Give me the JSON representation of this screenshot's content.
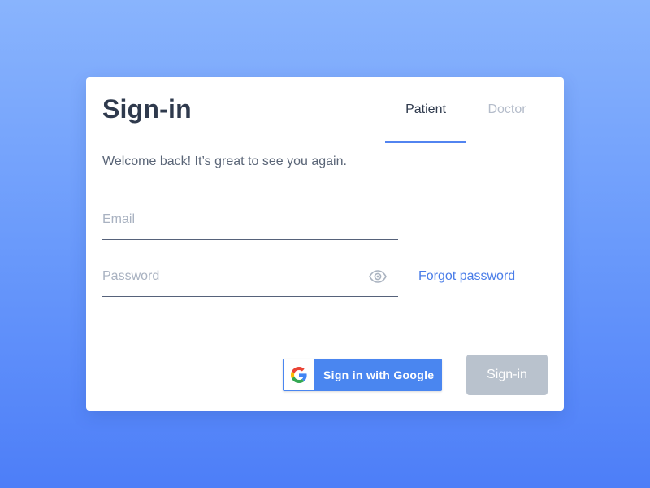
{
  "card": {
    "title": "Sign-in",
    "tabs": [
      {
        "label": "Patient",
        "active": true
      },
      {
        "label": "Doctor",
        "active": false
      }
    ],
    "welcome_text": "Welcome back! It’s great to see you again."
  },
  "form": {
    "email": {
      "placeholder": "Email",
      "value": ""
    },
    "password": {
      "placeholder": "Password",
      "value": ""
    },
    "show_password_icon": "eye-icon",
    "forgot_password_label": "Forgot password"
  },
  "footer": {
    "google_button_label": "Sign in with Google",
    "google_icon": "google-logo-icon",
    "signin_button_label": "Sign-in"
  },
  "colors": {
    "accent": "#5284f0",
    "link": "#4a7de8",
    "google_button": "#4a86f0",
    "disabled_button": "#b9c2cd",
    "title_text": "#2f3a4d"
  }
}
